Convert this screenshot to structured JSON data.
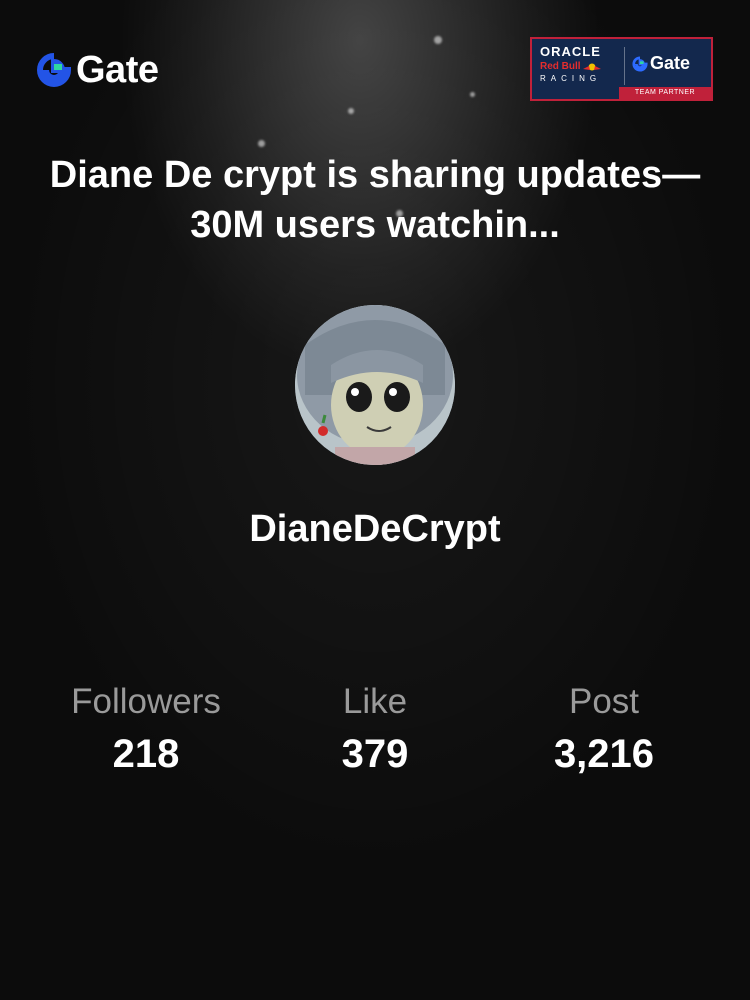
{
  "brand": {
    "name": "Gate",
    "accent": "#2354e6"
  },
  "partner": {
    "top_line": "ORACLE",
    "middle_line": "Red Bull",
    "bottom_line": "RACING",
    "brand_name": "Gate",
    "tag": "TEAM PARTNER",
    "background": "#13284d",
    "accent": "#c0213a"
  },
  "headline": "Diane De crypt is sharing updates—30M users watchin...",
  "profile": {
    "username": "DianeDeCrypt"
  },
  "stats": [
    {
      "label": "Followers",
      "value": "218"
    },
    {
      "label": "Like",
      "value": "379"
    },
    {
      "label": "Post",
      "value": "3,216"
    }
  ]
}
